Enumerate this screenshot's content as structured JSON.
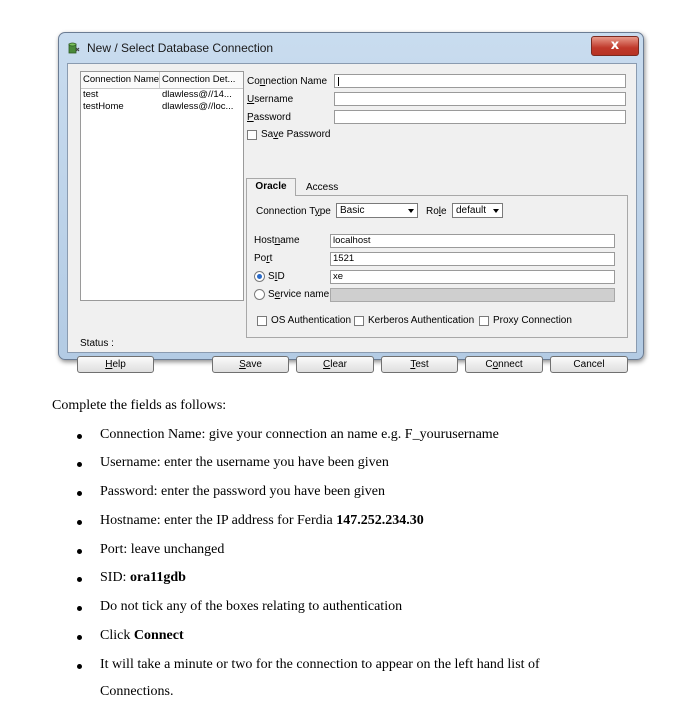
{
  "dialog": {
    "title": "New / Select Database Connection",
    "close_label": "x",
    "list": {
      "headers": [
        "Connection Name",
        "Connection Det..."
      ],
      "rows": [
        [
          "test",
          "dlawless@//14..."
        ],
        [
          "testHome",
          "dlawless@//loc..."
        ]
      ]
    },
    "form": {
      "connection_name_label_pre": "Co",
      "connection_name_label_u": "n",
      "connection_name_label_post": "nection Name",
      "connection_name_value": "",
      "username_label_u": "U",
      "username_label_post": "sername",
      "username_value": "",
      "password_label_u": "P",
      "password_label_post": "assword",
      "password_value": "",
      "save_password_pre": "Sa",
      "save_password_u": "v",
      "save_password_post": "e Password"
    },
    "tabs": [
      "Oracle",
      "Access"
    ],
    "oracle": {
      "connection_type_pre": "Connection T",
      "connection_type_u": "y",
      "connection_type_post": "pe",
      "connection_type_value": "Basic",
      "role_pre": "Ro",
      "role_u": "l",
      "role_post": "e",
      "role_value": "default",
      "hostname_pre": "Host",
      "hostname_u": "n",
      "hostname_post": "ame",
      "hostname_value": "localhost",
      "port_pre": "Po",
      "port_u": "r",
      "port_post": "t",
      "port_value": "1521",
      "sid_pre": "S",
      "sid_u": "I",
      "sid_post": "D",
      "sid_value": "xe",
      "service_pre": "S",
      "service_u": "e",
      "service_post": "rvice name",
      "service_value": "",
      "os_auth": "OS Authentication",
      "kerberos_auth": "Kerberos Authentication",
      "proxy_conn": "Proxy Connection"
    },
    "status_label": "Status :",
    "buttons": {
      "help_u": "H",
      "help_post": "elp",
      "save_u": "S",
      "save_post": "ave",
      "clear_u": "C",
      "clear_post": "lear",
      "test_u": "T",
      "test_post": "est",
      "connect_pre": "C",
      "connect_u": "o",
      "connect_post": "nnect",
      "cancel": "Cancel"
    }
  },
  "doc": {
    "intro": "Complete the fields as follows:",
    "b1": "Connection Name: give your connection an name e.g. F_yourusername",
    "b2": "Username: enter the username you have been given",
    "b3": "Password: enter the password you have been given",
    "b4_text": "Hostname: enter the IP address for Ferdia ",
    "b4_bold": "147.252.234.30",
    "b5": "Port: leave unchanged",
    "b6_text": "SID: ",
    "b6_bold": "ora11gdb",
    "b7": "Do not tick any of the boxes relating to authentication",
    "b8_text": "Click ",
    "b8_bold": "Connect",
    "b9_line1": "It will take a minute or two for the connection to appear on the left hand list of",
    "b9_line2": "Connections."
  }
}
